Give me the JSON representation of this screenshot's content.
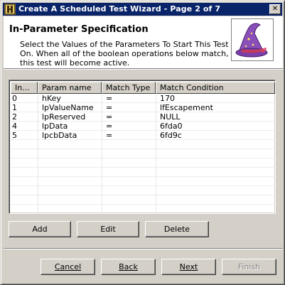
{
  "window": {
    "title": "Create A Scheduled Test Wizard - Page 2 of 7",
    "close_label": "✕"
  },
  "header": {
    "title": "In-Parameter Specification",
    "description": "Select the Values of the Parameters To Start This Test On. When all of the boolean operations below match, this test will become active."
  },
  "table": {
    "columns": [
      "In...",
      "Param name",
      "Match Type",
      "Match Condition"
    ],
    "rows": [
      [
        "0",
        "hKey",
        "=",
        "170"
      ],
      [
        "1",
        "lpValueName",
        "=",
        "lfEscapement"
      ],
      [
        "2",
        "lpReserved",
        "=",
        "NULL"
      ],
      [
        "4",
        "lpData",
        "=",
        "6fda0"
      ],
      [
        "5",
        "lpcbData",
        "=",
        "6fd9c"
      ]
    ]
  },
  "actions": {
    "add": "Add",
    "edit": "Edit",
    "delete": "Delete"
  },
  "nav": {
    "cancel": "Cancel",
    "back": "Back",
    "next": "Next",
    "finish": "Finish"
  },
  "colors": {
    "titlebar": "#0a246a",
    "face": "#d4d0c8",
    "hat": "#8a4fb8"
  }
}
